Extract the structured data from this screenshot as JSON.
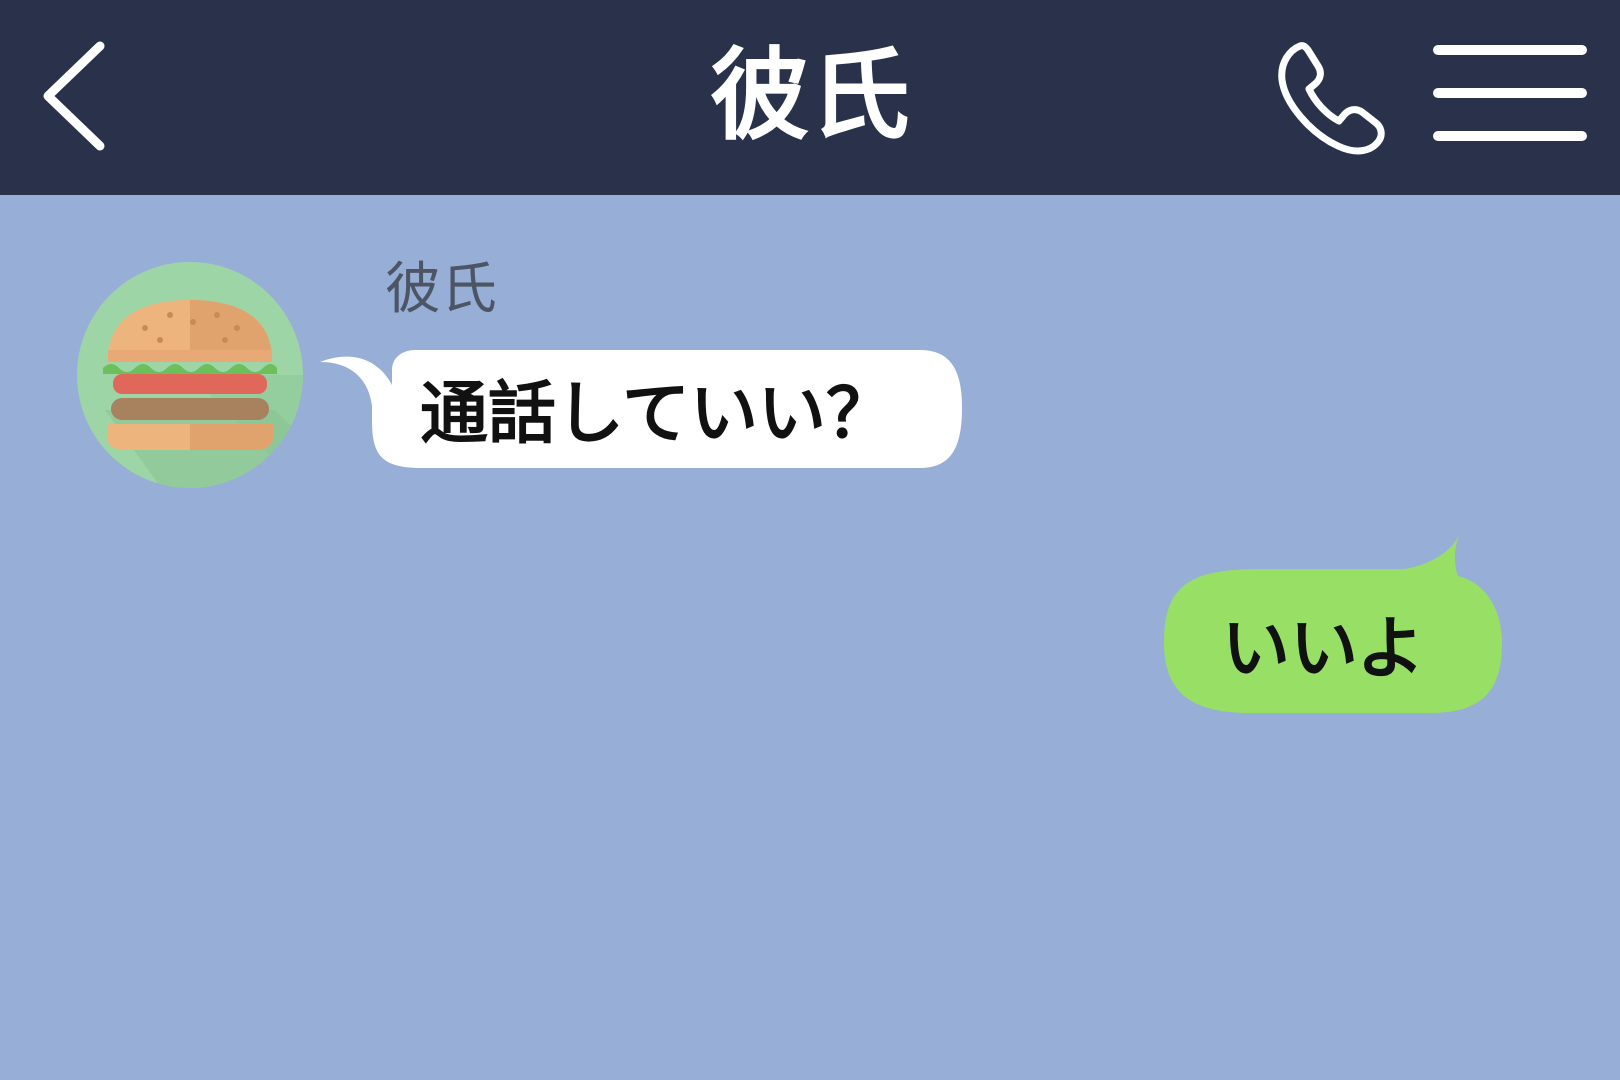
{
  "header": {
    "title": "彼氏",
    "back_icon": "chevron-left-icon",
    "call_icon": "phone-icon",
    "menu_icon": "hamburger-menu-icon"
  },
  "messages": [
    {
      "direction": "incoming",
      "sender": "彼氏",
      "avatar_icon": "hamburger-food-icon",
      "text": "通話していい？"
    },
    {
      "direction": "outgoing",
      "text": "いいよ"
    }
  ],
  "colors": {
    "header_bg": "#29324a",
    "chat_bg": "#97aed7",
    "incoming_bubble": "#ffffff",
    "outgoing_bubble": "#98df66",
    "avatar_bg": "#9ed5a6"
  }
}
